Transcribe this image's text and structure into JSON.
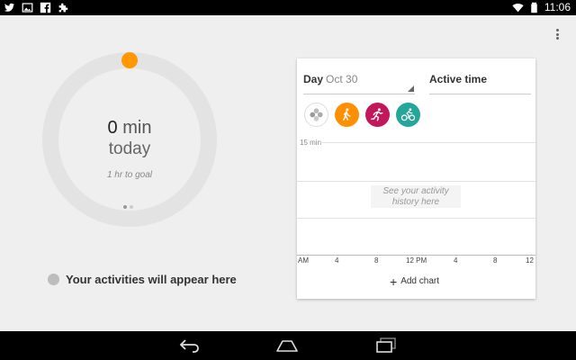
{
  "status_bar": {
    "time": "11:06",
    "icons_left": [
      "twitter-icon",
      "image-icon",
      "facebook-icon",
      "puzzle-icon"
    ],
    "icons_right": [
      "wifi-icon",
      "battery-icon"
    ]
  },
  "summary": {
    "minutes": "0",
    "unit": "min",
    "period": "today",
    "goal": "1 hr to goal",
    "ring_progress": 0,
    "accent_color": "#ff9800",
    "ring_color": "#e3e3e3",
    "pager": {
      "count": 2,
      "active": 0
    }
  },
  "activities_message": "Your activities will appear here",
  "chart_card": {
    "range_label": "Day",
    "range_value": "Oct 30",
    "metric_label": "Active time",
    "activities": [
      {
        "name": "all-activities",
        "color": "#ffffff"
      },
      {
        "name": "walking",
        "color": "#ff8f00"
      },
      {
        "name": "running",
        "color": "#c2185b"
      },
      {
        "name": "biking",
        "color": "#26a69a"
      }
    ],
    "y_label": "15 min",
    "empty_text_1": "See your activity",
    "empty_text_2": "history here",
    "x_ticks": [
      "AM",
      "4",
      "8",
      "12 PM",
      "4",
      "8",
      "12"
    ],
    "add_chart_label": "Add chart"
  },
  "nav_bar": {
    "buttons": [
      "back-icon",
      "home-icon",
      "recents-icon"
    ]
  }
}
